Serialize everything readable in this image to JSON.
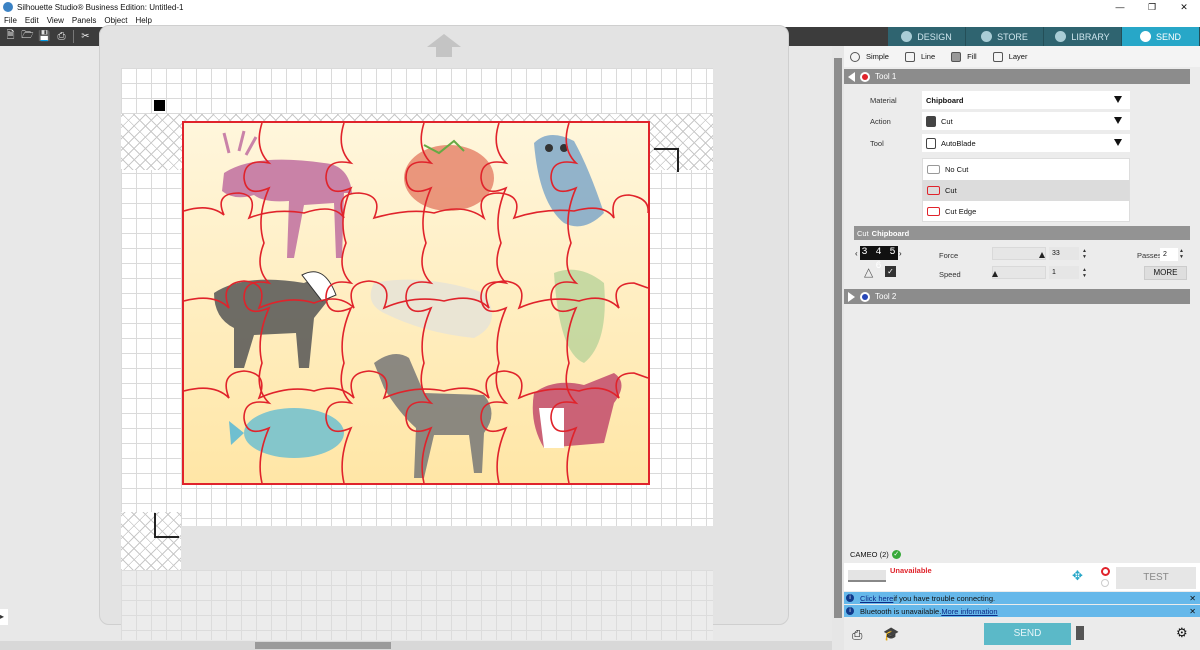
{
  "window": {
    "title": "Silhouette Studio® Business Edition: Untitled-1"
  },
  "menu": [
    "File",
    "Edit",
    "View",
    "Panels",
    "Object",
    "Help"
  ],
  "top_tabs": [
    {
      "label": "DESIGN",
      "active": false
    },
    {
      "label": "STORE",
      "active": false
    },
    {
      "label": "LIBRARY",
      "active": false
    },
    {
      "label": "SEND",
      "active": true
    }
  ],
  "mode_tabs": [
    "Simple",
    "Line",
    "Fill",
    "Layer"
  ],
  "tool1": {
    "header": "Tool 1",
    "color": "#e0232b",
    "material_label": "Material",
    "material_value": "Chipboard",
    "action_label": "Action",
    "action_value": "Cut",
    "tool_label": "Tool",
    "tool_value": "AutoBlade",
    "actions": [
      "No Cut",
      "Cut",
      "Cut Edge"
    ],
    "selected_action": "Cut"
  },
  "cut_settings": {
    "title_prefix": "Cut",
    "title_material": "Chipboard",
    "blade_digits": "3 4 5 6",
    "force_label": "Force",
    "force_value": "33",
    "force_level": 0.94,
    "speed_label": "Speed",
    "speed_value": "1",
    "speed_level": 0.03,
    "passes_label": "Passes",
    "passes_value": "2",
    "more_label": "MORE"
  },
  "tool2": {
    "header": "Tool 2",
    "color": "#2747b8"
  },
  "device": {
    "name": "CAMEO (2)",
    "status": "Unavailable",
    "test_label": "TEST"
  },
  "notices": [
    {
      "link": "Click here",
      "text": " if you have trouble connecting."
    },
    {
      "text": "Bluetooth is unavailable. ",
      "link": "More information"
    }
  ],
  "send_label": "SEND",
  "colors": {
    "cut_line": "#e0232b",
    "send_tab": "#27a7c8",
    "panel_dark_tab": "#2f6470",
    "info_bar": "#66b8ea"
  }
}
